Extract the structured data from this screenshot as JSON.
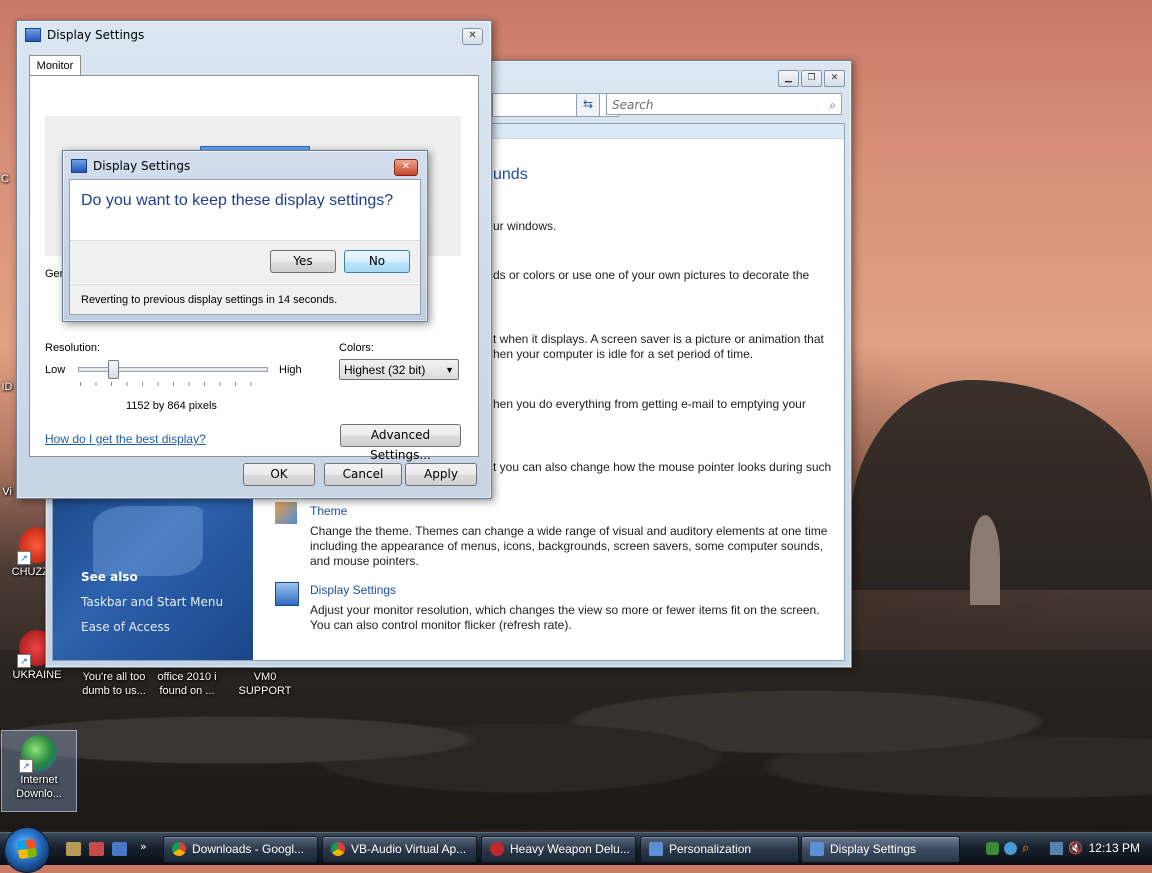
{
  "desktop": {
    "icons": [
      {
        "label": "CHUZZLE",
        "x": "chuzzle"
      },
      {
        "label": "UKRAINE",
        "x": "ukraine"
      },
      {
        "label": "You're all too dumb to us...",
        "x": "dumb"
      },
      {
        "label": "office 2010 i found on ...",
        "x": "office"
      },
      {
        "label": "VM0 SUPPORT",
        "x": "vm0"
      },
      {
        "label": "Internet Downlo...",
        "x": "idm"
      }
    ],
    "edge_fragments": {
      "c": "C",
      "id": "ID",
      "vi": "Vi"
    }
  },
  "personalization": {
    "search_placeholder": "Search",
    "heading_fragment": "unds",
    "items": [
      {
        "text": "ur windows."
      },
      {
        "text": "ds or colors or use one of your own pictures to decorate the"
      },
      {
        "text": "t when it displays. A screen saver is a picture or animation that"
      },
      {
        "text": "hen your computer is idle for a set period of time."
      },
      {
        "text": "hen you do everything from getting e-mail to emptying your"
      },
      {
        "text": "t you can also change how the mouse pointer looks during such"
      }
    ],
    "theme": {
      "title": "Theme",
      "desc1": "Change the theme. Themes can change a wide range of visual and auditory elements at one time",
      "desc2": "including the appearance of menus, icons, backgrounds, screen savers, some computer sounds,",
      "desc3": "and mouse pointers."
    },
    "display": {
      "title": "Display Settings",
      "desc1": "Adjust your monitor resolution, which changes the view so more or fewer items fit on the screen.",
      "desc2": "You can also control monitor flicker (refresh rate)."
    },
    "see_also": "See also",
    "side_links": [
      "Taskbar and Start Menu",
      "Ease of Access"
    ]
  },
  "display_settings": {
    "title": "Display Settings",
    "tab": "Monitor",
    "gen_fragment": "Ger",
    "resolution_label": "Resolution:",
    "low": "Low",
    "high": "High",
    "resolution_value": "1152 by 864 pixels",
    "colors_label": "Colors:",
    "colors_value": "Highest (32 bit)",
    "help_link": "How do I get the best display?",
    "advanced": "Advanced Settings...",
    "ok": "OK",
    "cancel": "Cancel",
    "apply": "Apply",
    "slider_position": 0.18
  },
  "confirm": {
    "title": "Display Settings",
    "question": "Do you want to keep these display settings?",
    "yes": "Yes",
    "no": "No",
    "reverting": "Reverting to previous display settings in 14 seconds."
  },
  "taskbar": {
    "buttons": [
      {
        "label": "Downloads - Googl...",
        "icon_color": "#e8b520"
      },
      {
        "label": "VB-Audio Virtual Ap...",
        "icon_color": "#e8b520"
      },
      {
        "label": "Heavy Weapon Delu...",
        "icon_color": "#c0282b"
      },
      {
        "label": "Personalization",
        "icon_color": "#5b8fd6"
      },
      {
        "label": "Display Settings",
        "icon_color": "#5b8fd6"
      }
    ],
    "clock": "12:13 PM"
  }
}
